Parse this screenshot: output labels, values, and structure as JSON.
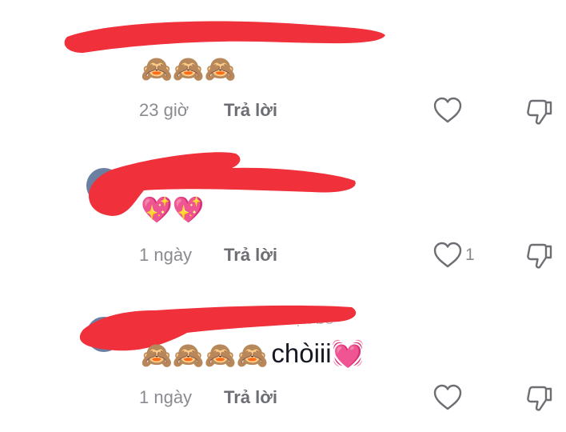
{
  "colors": {
    "redaction": "#f0303a",
    "meta_text": "#8a8b91",
    "reply_text": "#6d6e73",
    "icon_stroke": "#6d6e73"
  },
  "comments": [
    {
      "emojis": [
        "🙈",
        "🙈",
        "🙈"
      ],
      "text": "",
      "time": "23 giờ",
      "reply_label": "Trả lời",
      "like_count": "",
      "like_icon": "heart-outline-icon",
      "dislike_icon": "thumbs-down-icon"
    },
    {
      "emojis": [
        "💖",
        "💖"
      ],
      "text": "",
      "time": "1 ngày",
      "reply_label": "Trả lời",
      "like_count": "1",
      "like_icon": "heart-outline-icon",
      "dislike_icon": "thumbs-down-icon"
    },
    {
      "emojis": [
        "🙈",
        "🙈",
        "🙈",
        "🙈"
      ],
      "text": "chòiii💓",
      "time": "1 ngày",
      "reply_label": "Trả lời",
      "like_count": "",
      "like_icon": "heart-outline-icon",
      "dislike_icon": "thumbs-down-icon",
      "author_suffix": "Bạn bè"
    }
  ]
}
